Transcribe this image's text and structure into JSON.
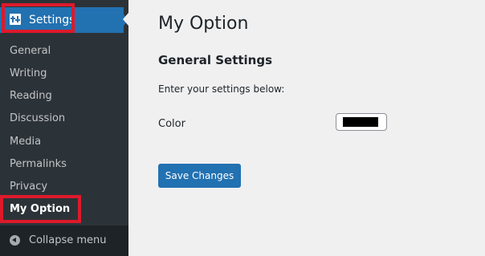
{
  "sidebar": {
    "settings_label": "Settings",
    "items": [
      {
        "label": "General"
      },
      {
        "label": "Writing"
      },
      {
        "label": "Reading"
      },
      {
        "label": "Discussion"
      },
      {
        "label": "Media"
      },
      {
        "label": "Permalinks"
      },
      {
        "label": "Privacy"
      },
      {
        "label": "My Option",
        "active": true
      }
    ],
    "collapse_label": "Collapse menu",
    "colors": {
      "background": "#2c3338",
      "active_header": "#2271b1",
      "collapse_bg": "#1d2327"
    }
  },
  "highlight_color": "#dd1a2b",
  "main": {
    "title": "My Option",
    "section_title": "General Settings",
    "intro": "Enter your settings below:",
    "color_label": "Color",
    "color_value": "#000000",
    "save_label": "Save Changes"
  }
}
